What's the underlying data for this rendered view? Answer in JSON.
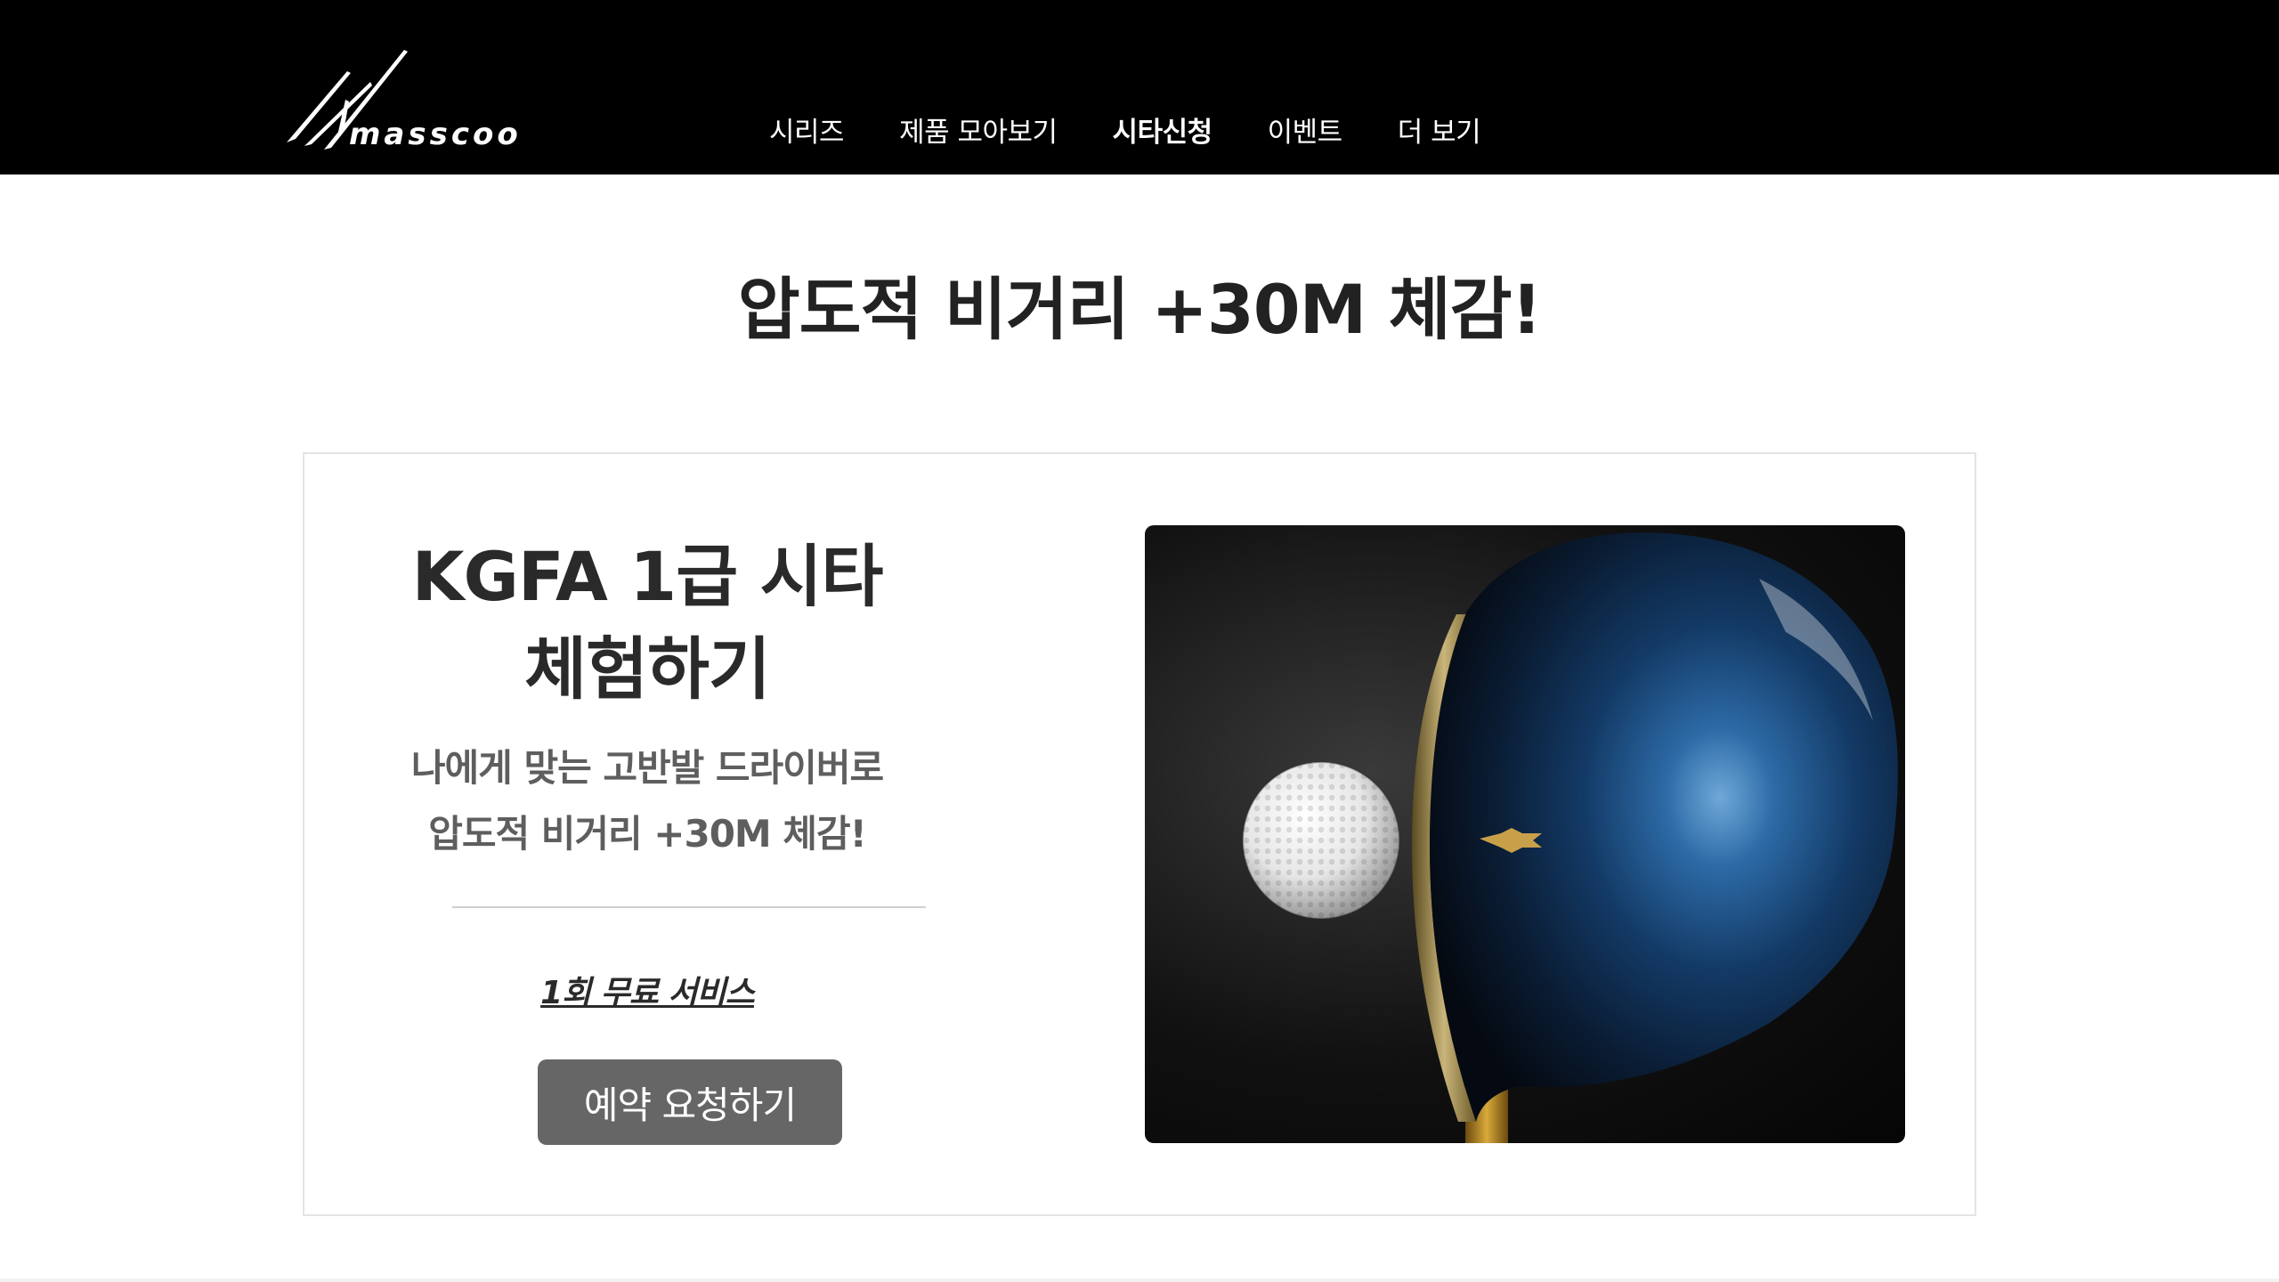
{
  "header": {
    "brand": "masscoo",
    "nav": [
      {
        "label": "시리즈",
        "active": false
      },
      {
        "label": "제품 모아보기",
        "active": false
      },
      {
        "label": "시타신청",
        "active": true
      },
      {
        "label": "이벤트",
        "active": false
      },
      {
        "label": "더 보기",
        "active": false
      }
    ]
  },
  "hero": {
    "title": "압도적 비거리 +30M 체감!"
  },
  "card": {
    "title_line1": "KGFA 1급 시타",
    "title_line2": "체험하기",
    "subtitle_line1": "나에게 맞는 고반발 드라이버로",
    "subtitle_line2": "압도적 비거리 +30M 체감!",
    "free_label": "1회 무료 서비스",
    "cta_label": "예약 요청하기",
    "image": "golf-driver-and-ball-photo"
  },
  "colors": {
    "header_bg": "#000000",
    "cta_bg": "#666666",
    "card_border": "#e4e4e4",
    "driver_face": "#1f4f86"
  }
}
